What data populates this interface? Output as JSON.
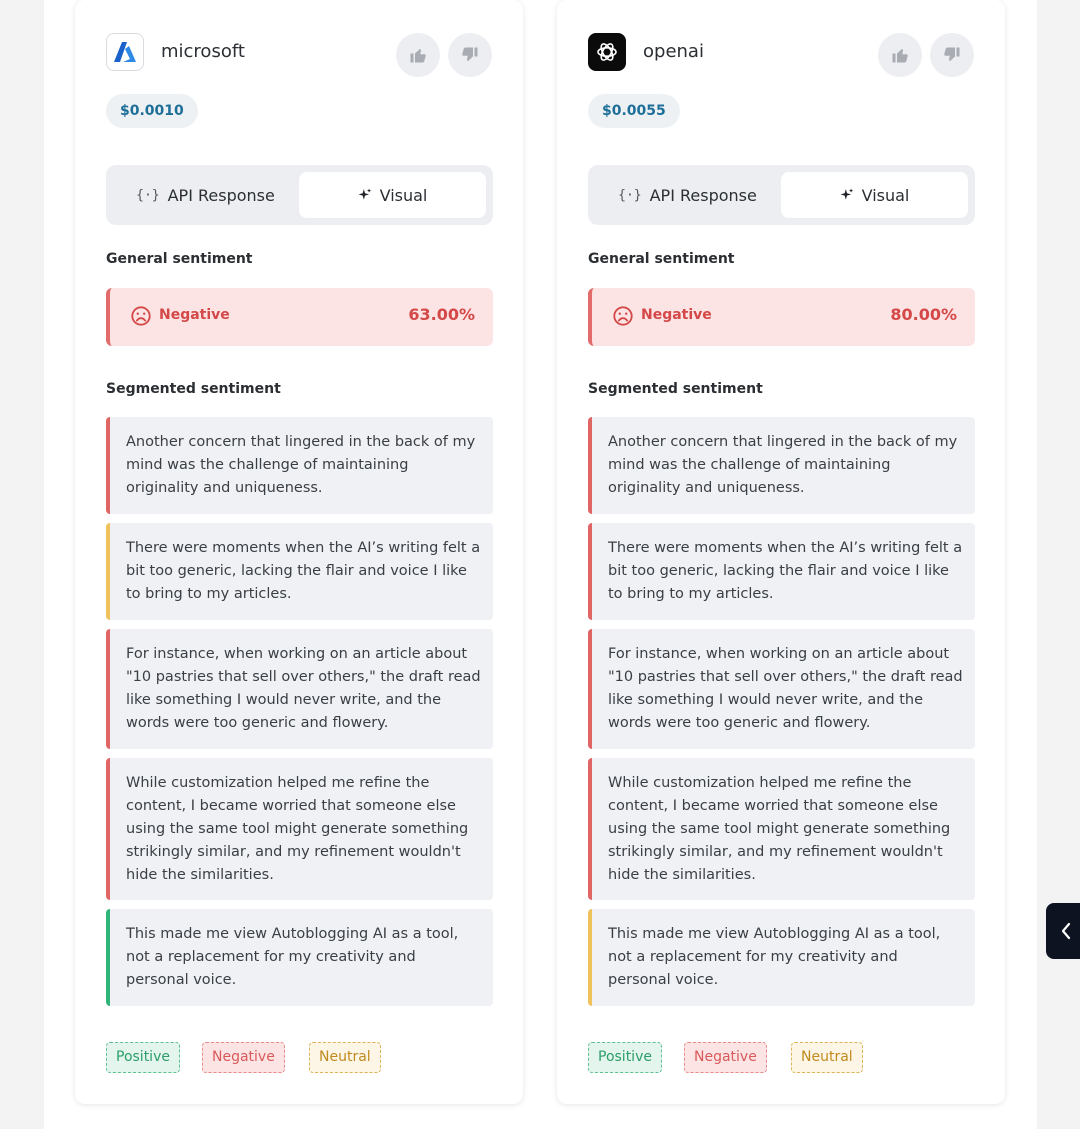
{
  "colors": {
    "negative": "#e06666",
    "neutral": "#efc25c",
    "positive": "#2fb57a",
    "price_text": "#1d6f99"
  },
  "cards": [
    {
      "provider": "microsoft",
      "logo_icon": "azure-logo-icon",
      "price": "$0.0010",
      "tabs": {
        "api": "API Response",
        "visual": "Visual"
      },
      "general_title": "General sentiment",
      "overall": {
        "label": "Negative",
        "percent": "63.00%"
      },
      "segmented_title": "Segmented sentiment",
      "segments": [
        {
          "sentiment": "negative",
          "text": "Another concern that lingered in the back of my mind was the challenge of maintaining originality and uniqueness."
        },
        {
          "sentiment": "neutral",
          "text": "There were moments when the AI’s writing felt a bit too generic, lacking the flair and voice I like to bring to my articles."
        },
        {
          "sentiment": "negative",
          "text": "For instance, when working on an article about \"10 pastries that sell over others,\" the draft read like something I would never write, and the words were too generic and flowery."
        },
        {
          "sentiment": "negative",
          "text": "While customization helped me refine the content, I became worried that someone else using the same tool might generate something strikingly similar, and my refinement wouldn't hide the similarities."
        },
        {
          "sentiment": "positive",
          "text": "This made me view Autoblogging AI as a tool, not a replacement for my creativity and personal voice."
        }
      ],
      "legend": {
        "positive": "Positive",
        "negative": "Negative",
        "neutral": "Neutral"
      }
    },
    {
      "provider": "openai",
      "logo_icon": "openai-logo-icon",
      "price": "$0.0055",
      "tabs": {
        "api": "API Response",
        "visual": "Visual"
      },
      "general_title": "General sentiment",
      "overall": {
        "label": "Negative",
        "percent": "80.00%"
      },
      "segmented_title": "Segmented sentiment",
      "segments": [
        {
          "sentiment": "negative",
          "text": "Another concern that lingered in the back of my mind was the challenge of maintaining originality and uniqueness."
        },
        {
          "sentiment": "negative",
          "text": "There were moments when the AI’s writing felt a bit too generic, lacking the flair and voice I like to bring to my articles."
        },
        {
          "sentiment": "negative",
          "text": "For instance, when working on an article about \"10 pastries that sell over others,\" the draft read like something I would never write, and the words were too generic and flowery."
        },
        {
          "sentiment": "negative",
          "text": "While customization helped me refine the content, I became worried that someone else using the same tool might generate something strikingly similar, and my refinement wouldn't hide the similarities."
        },
        {
          "sentiment": "neutral",
          "text": "This made me view Autoblogging AI as a tool, not a replacement for my creativity and personal voice."
        }
      ],
      "legend": {
        "positive": "Positive",
        "negative": "Negative",
        "neutral": "Neutral"
      }
    }
  ]
}
